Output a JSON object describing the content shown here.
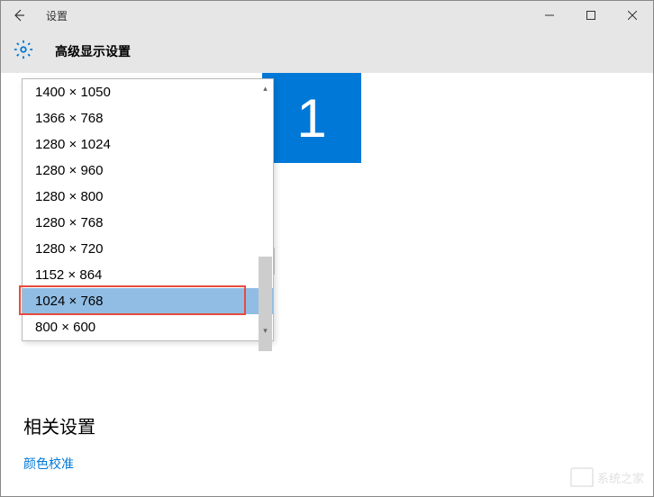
{
  "titlebar": {
    "title": "设置"
  },
  "header": {
    "title": "高级显示设置"
  },
  "monitor": {
    "number": "1"
  },
  "dropdown": {
    "items": [
      {
        "label": "1400 × 1050",
        "selected": false
      },
      {
        "label": "1366 × 768",
        "selected": false
      },
      {
        "label": "1280 × 1024",
        "selected": false
      },
      {
        "label": "1280 × 960",
        "selected": false
      },
      {
        "label": "1280 × 800",
        "selected": false
      },
      {
        "label": "1280 × 768",
        "selected": false
      },
      {
        "label": "1280 × 720",
        "selected": false
      },
      {
        "label": "1152 × 864",
        "selected": false
      },
      {
        "label": "1024 × 768",
        "selected": true
      },
      {
        "label": "800 × 600",
        "selected": false
      }
    ]
  },
  "related": {
    "title": "相关设置",
    "link": "颜色校准"
  },
  "watermark": {
    "text": "系统之家"
  }
}
